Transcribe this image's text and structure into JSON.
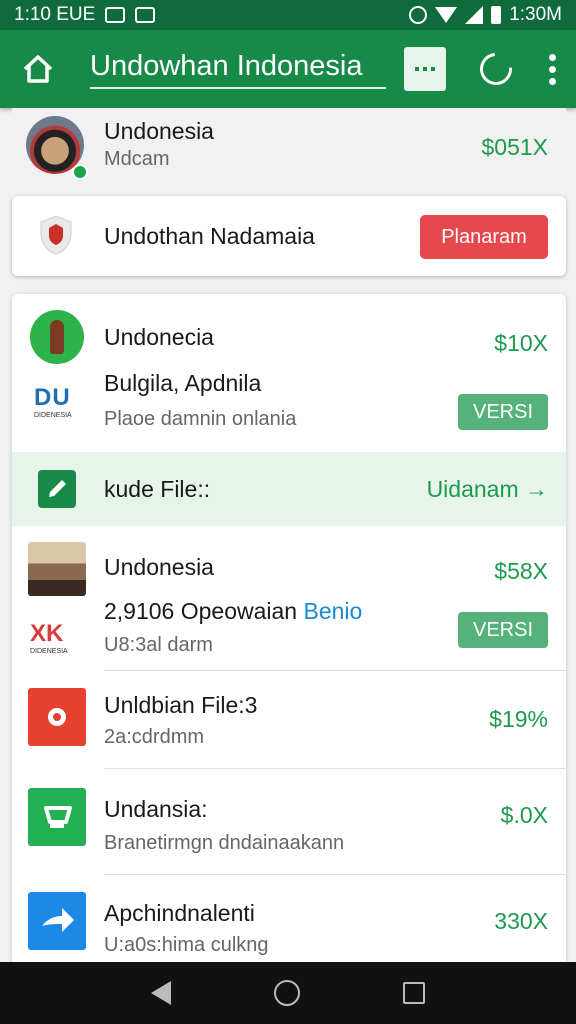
{
  "status_bar": {
    "time": "1:10 EUE",
    "right_text": "1:30M"
  },
  "app_bar": {
    "title": "Undowhan Indonesia"
  },
  "profile": {
    "name": "Undonesia",
    "sub": "Mdcam",
    "pct": "$051X"
  },
  "card": {
    "name": "Undothan Nadamaia",
    "button": "Planaram"
  },
  "list": [
    {
      "name": "Undonecia",
      "pct": "$10X"
    },
    {
      "name": "Bulgila, Apdnila",
      "sub": "Plaoe damnin onlania",
      "badge": "VERSI",
      "logo_text": "DU",
      "logo_sub": "DIDENESIA"
    },
    {
      "name": "kude File::",
      "link": "Uidanam"
    },
    {
      "name": "Undonesia",
      "pct": "$58X"
    },
    {
      "name": "2,9106 Opeowaian",
      "name_accent": "Benio",
      "sub": "U8:3al darm",
      "badge": "VERSI",
      "logo_text": "XK",
      "logo_sub": "DIDENESIA"
    },
    {
      "name": "Unldbian File:3",
      "sub": "2a:cdrdmm",
      "pct": "$19%"
    },
    {
      "name": "Undansia:",
      "sub": "Branetirmgn dndainaakann",
      "pct": "$.0X"
    },
    {
      "name": "Apchindnalenti",
      "sub": "U:a0s:hima culkng",
      "pct": "330X"
    }
  ],
  "colors": {
    "brand_green": "#188a48",
    "dark_green": "#0f6b3c",
    "accent_red": "#e5484d",
    "pct_green": "#1e9a4e",
    "link_blue": "#1a8ad0"
  }
}
